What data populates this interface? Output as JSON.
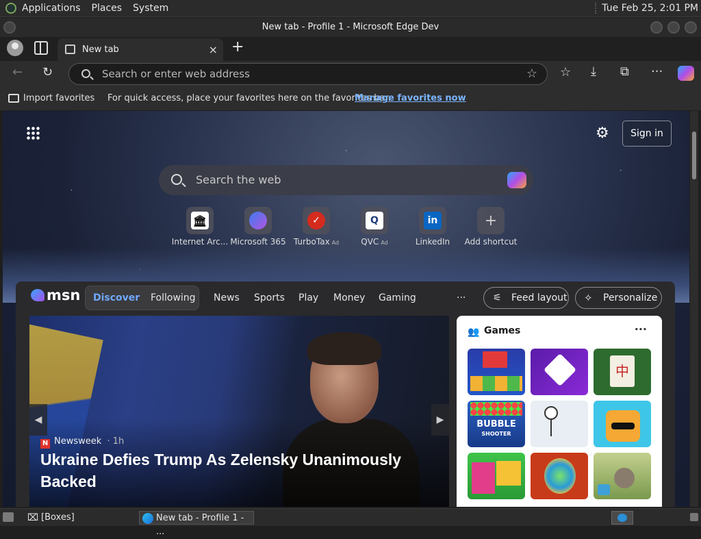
{
  "panel": {
    "menus": [
      "Applications",
      "Places",
      "System"
    ],
    "clock": "Tue Feb 25,  2:01 PM"
  },
  "window": {
    "title": "New tab - Profile 1 - Microsoft Edge Dev"
  },
  "tabs": [
    {
      "label": "New tab",
      "close": "×"
    }
  ],
  "toolbar": {
    "address_placeholder": "Search or enter web address"
  },
  "favorites_bar": {
    "import_label": "Import favorites",
    "message": "For quick access, place your favorites here on the favorites bar.",
    "manage_link": "Manage favorites now"
  },
  "ntp": {
    "sign_in": "Sign in",
    "search_placeholder": "Search the web",
    "shortcuts": [
      {
        "label": "Internet Arc...",
        "icon": "museum-icon",
        "ad": ""
      },
      {
        "label": "Microsoft 365",
        "icon": "m365-icon",
        "ad": ""
      },
      {
        "label": "TurboTax",
        "icon": "turbotax-icon",
        "ad": "Ad"
      },
      {
        "label": "QVC",
        "icon": "qvc-icon",
        "ad": "Ad"
      },
      {
        "label": "LinkedIn",
        "icon": "linkedin-icon",
        "ad": ""
      },
      {
        "label": "Add shortcut",
        "icon": "plus-icon",
        "ad": ""
      }
    ]
  },
  "feed": {
    "logo": "msn",
    "pill": [
      "Discover",
      "Following"
    ],
    "nav": [
      "News",
      "Sports",
      "Play",
      "Money",
      "Gaming"
    ],
    "more": "···",
    "feed_layout": "Feed layout",
    "personalize": "Personalize",
    "hero": {
      "source": "Newsweek",
      "source_letter": "N",
      "age": "· 1h",
      "title": "Ukraine Defies Trump As Zelensky Unanimously Backed"
    },
    "games": {
      "title": "Games",
      "more": "···",
      "tile_text": [
        "BUBBLE",
        "SHOOTER"
      ]
    }
  },
  "taskbar": {
    "items": [
      "[Boxes]",
      "New tab - Profile 1 - ..."
    ]
  },
  "colors": {
    "accent_link": "#7ab4ff",
    "newsweek_red": "#e4322b"
  }
}
